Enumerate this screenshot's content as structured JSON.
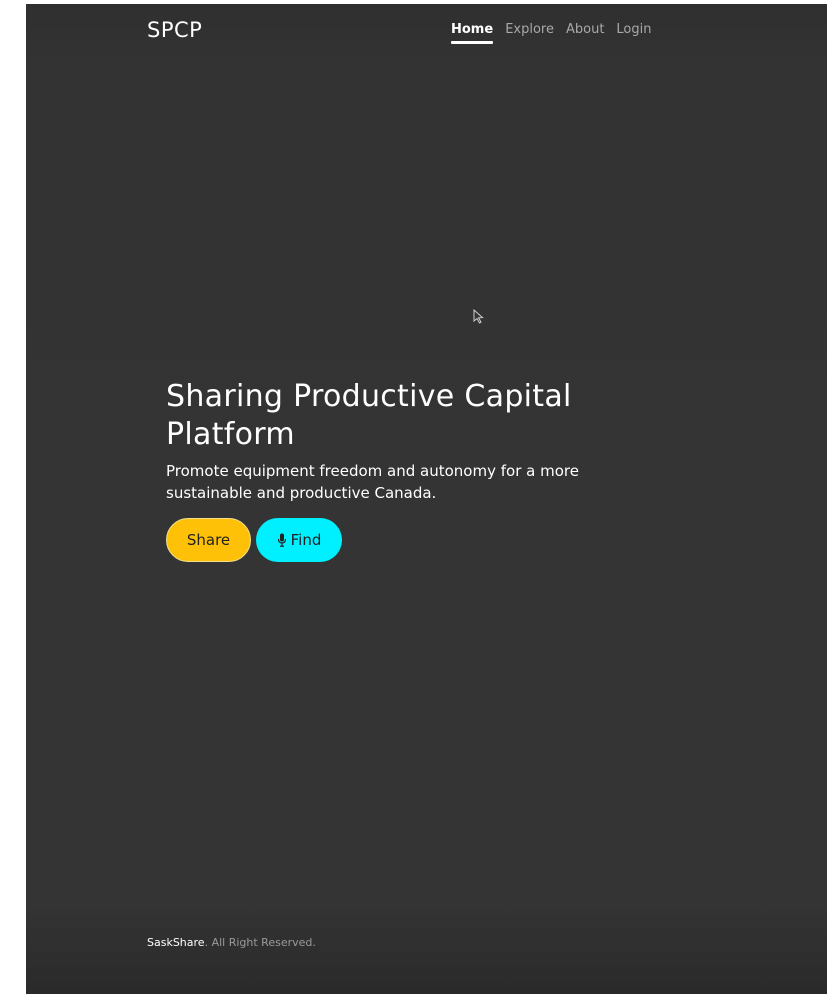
{
  "header": {
    "brand": "SPCP",
    "nav": [
      {
        "label": "Home",
        "active": true
      },
      {
        "label": "Explore",
        "active": false
      },
      {
        "label": "About",
        "active": false
      },
      {
        "label": "Login",
        "active": false
      }
    ]
  },
  "hero": {
    "title": "Sharing Productive Capital Platform",
    "subtitle": "Promote equipment freedom and autonomy for a more sustainable and productive Canada.",
    "share_label": "Share",
    "find_label": "Find",
    "find_icon": "microphone-icon"
  },
  "footer": {
    "brand": "SaskShare",
    "rights": ". All Right Reserved."
  },
  "colors": {
    "background": "#333333",
    "share_button": "#ffc107",
    "find_button": "#00f0ff",
    "text": "#ffffff",
    "nav_inactive": "#a8a8a8"
  }
}
